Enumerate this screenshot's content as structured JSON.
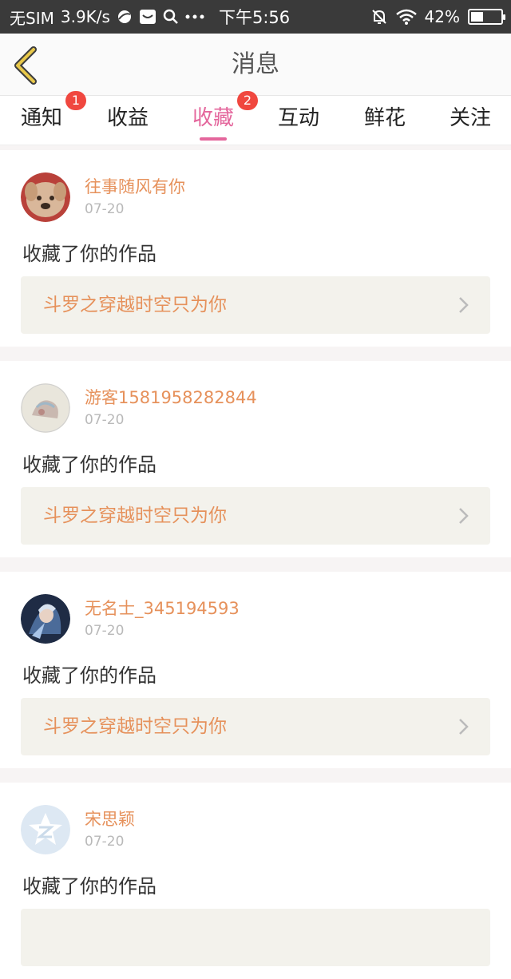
{
  "status_bar": {
    "carrier": "无SIM",
    "speed": "3.9K/s",
    "time": "下午5:56",
    "battery": "42%",
    "battery_level": 0.42
  },
  "header": {
    "title": "消息"
  },
  "tabs": [
    {
      "label": "通知",
      "badge": "1"
    },
    {
      "label": "收益",
      "badge": ""
    },
    {
      "label": "收藏",
      "badge": "2",
      "active": true
    },
    {
      "label": "互动",
      "badge": ""
    },
    {
      "label": "鲜花",
      "badge": ""
    },
    {
      "label": "关注",
      "badge": ""
    }
  ],
  "messages": [
    {
      "username": "往事随风有你",
      "date": "07-20",
      "action": "收藏了你的作品",
      "work": "斗罗之穿越时空只为你"
    },
    {
      "username": "游客1581958282844",
      "date": "07-20",
      "action": "收藏了你的作品",
      "work": "斗罗之穿越时空只为你"
    },
    {
      "username": "无名士_345194593",
      "date": "07-20",
      "action": "收藏了你的作品",
      "work": "斗罗之穿越时空只为你"
    },
    {
      "username": "宋思颖",
      "date": "07-20",
      "action": "收藏了你的作品",
      "work": ""
    }
  ],
  "colors": {
    "accent": "#e4669c",
    "username": "#e6915b",
    "badge": "#f0473f",
    "link_bg": "#f3f2ec",
    "back_arrow": "#e8c84a"
  }
}
